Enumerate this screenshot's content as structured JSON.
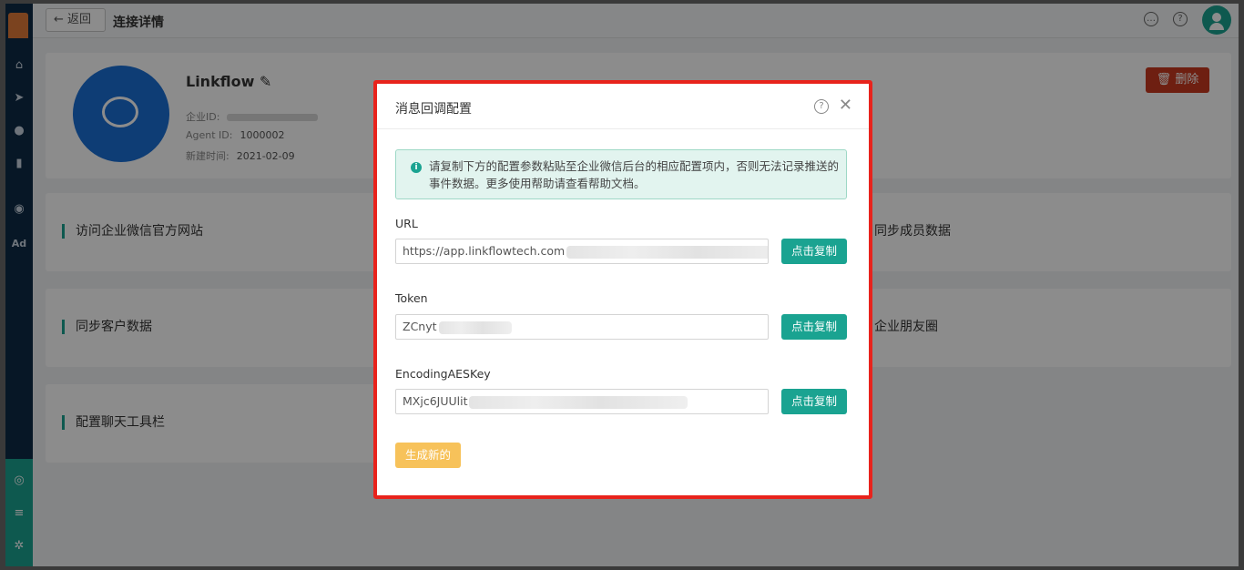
{
  "header": {
    "back_label": "← 返回",
    "title": "连接详情",
    "chat_icon": "comment-icon",
    "help_icon": "question-icon"
  },
  "profile": {
    "name": "Linkflow",
    "corp_id_label": "企业ID:",
    "agent_id_label": "Agent ID:",
    "agent_id_value": "1000002",
    "created_label": "新建时间:",
    "created_value": "2021-02-09",
    "delete_label": "删除"
  },
  "features": {
    "left": [
      "访问企业微信官方网站",
      "同步客户数据",
      "配置聊天工具栏"
    ],
    "right": [
      "同步成员数据",
      "企业朋友圈"
    ]
  },
  "modal": {
    "title": "消息回调配置",
    "alert": "请复制下方的配置参数粘贴至企业微信后台的相应配置项内，否则无法记录推送的事件数据。更多使用帮助请查看帮助文档。",
    "url_label": "URL",
    "url_value": "https://app.linkflowtech.com",
    "token_label": "Token",
    "token_value": "ZCnyt",
    "aes_label": "EncodingAESKey",
    "aes_value": "MXjc6JUUlit",
    "copy_label": "点击复制",
    "generate_label": "生成新的"
  },
  "colors": {
    "accent": "#1aa391",
    "danger": "#c8391f",
    "warning": "#f7c25a",
    "highlight_border": "#e8231c",
    "sidebar": "#0d2a45",
    "avatar_blue": "#1a6fd6"
  }
}
